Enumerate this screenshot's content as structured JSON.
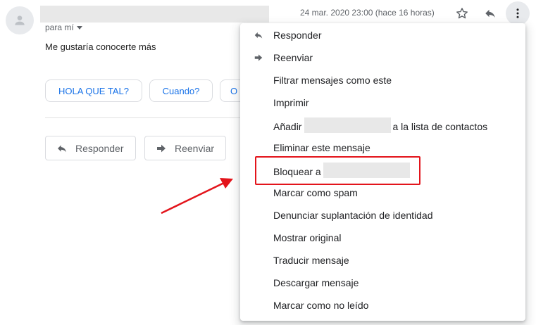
{
  "header": {
    "to_me_label": "para mí",
    "date": "24 mar. 2020 23:00 (hace 16 horas)"
  },
  "message": {
    "body": "Me gustaría conocerte más"
  },
  "smart_replies": [
    "HOLA QUE TAL?",
    "Cuando?",
    "O"
  ],
  "actions": {
    "reply_label": "Responder",
    "forward_label": "Reenviar"
  },
  "menu": {
    "items": [
      {
        "label": "Responder",
        "icon": "reply-icon"
      },
      {
        "label": "Reenviar",
        "icon": "forward-icon"
      },
      {
        "label": "Filtrar mensajes como este"
      },
      {
        "label": "Imprimir"
      },
      {
        "label": "Añadir",
        "suffix": "a la lista de contactos"
      },
      {
        "label": "Eliminar este mensaje"
      },
      {
        "label": "Bloquear a"
      },
      {
        "label": "Marcar como spam"
      },
      {
        "label": "Denunciar suplantación de identidad"
      },
      {
        "label": "Mostrar original"
      },
      {
        "label": "Traducir mensaje"
      },
      {
        "label": "Descargar mensaje"
      },
      {
        "label": "Marcar como no leído"
      }
    ]
  },
  "colors": {
    "link_blue": "#1a73e8",
    "highlight_red": "#e3141b",
    "icon_gray": "#5f6368"
  }
}
